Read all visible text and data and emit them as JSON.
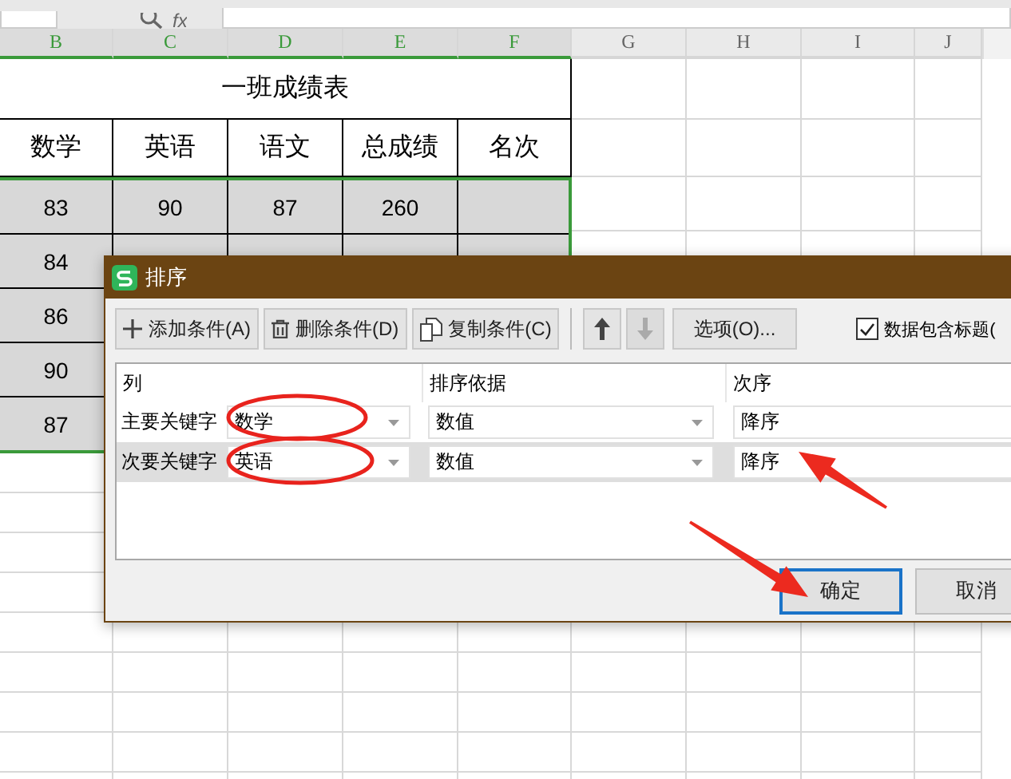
{
  "formula_bar": {
    "label": "fx"
  },
  "sheet": {
    "columns": [
      {
        "label": "B",
        "selected": true
      },
      {
        "label": "C",
        "selected": true
      },
      {
        "label": "D",
        "selected": true
      },
      {
        "label": "E",
        "selected": true
      },
      {
        "label": "F",
        "selected": true
      },
      {
        "label": "G",
        "selected": false
      },
      {
        "label": "H",
        "selected": false
      },
      {
        "label": "I",
        "selected": false
      },
      {
        "label": "J",
        "selected": false
      }
    ],
    "title": "一班成绩表",
    "headers": [
      "数学",
      "英语",
      "语文",
      "总成绩",
      "名次"
    ],
    "rows": [
      {
        "selected": true,
        "cells": [
          "83",
          "90",
          "87",
          "260"
        ]
      },
      {
        "selected": true,
        "cells": [
          "84"
        ]
      },
      {
        "selected": true,
        "cells": [
          "86"
        ]
      },
      {
        "selected": true,
        "cells": [
          "90"
        ]
      },
      {
        "selected": true,
        "cells": [
          "87"
        ]
      }
    ]
  },
  "dialog": {
    "title": "排序",
    "toolbar": [
      {
        "kind": "add",
        "label": "添加条件(A)",
        "disabled": false
      },
      {
        "kind": "delete",
        "label": "删除条件(D)",
        "disabled": false
      },
      {
        "kind": "copy",
        "label": "复制条件(C)",
        "disabled": false
      },
      {
        "kind": "up",
        "disabled": false
      },
      {
        "kind": "down",
        "disabled": true
      },
      {
        "kind": "text",
        "label": "选项(O)...",
        "disabled": false
      }
    ],
    "has_header": {
      "label": "数据包含标题(",
      "checked": true
    },
    "columns": [
      "列",
      "排序依据",
      "次序"
    ],
    "conditions": [
      {
        "label": "主要关键字",
        "key": "数学",
        "basis": "数值",
        "order": "降序",
        "selected": false
      },
      {
        "label": "次要关键字",
        "key": "英语",
        "basis": "数值",
        "order": "降序",
        "selected": true
      }
    ],
    "buttons": [
      {
        "label": "确定",
        "default": true
      },
      {
        "label": "取消",
        "default": false
      }
    ]
  }
}
